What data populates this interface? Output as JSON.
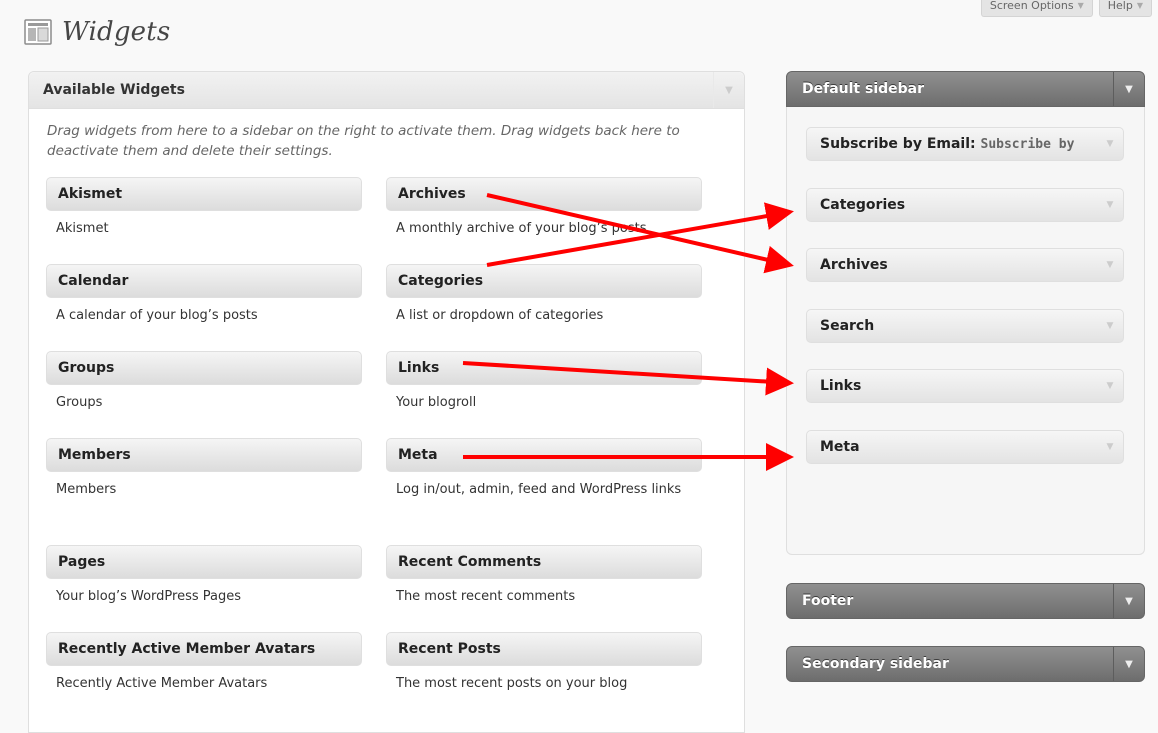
{
  "header": {
    "title": "Widgets",
    "screen_options_label": "Screen Options",
    "help_label": "Help",
    "dropdown_glyph": "▼"
  },
  "available": {
    "title": "Available Widgets",
    "description": "Drag widgets from here to a sidebar on the right to activate them. Drag widgets back here to deactivate them and delete their settings.",
    "widgets": [
      {
        "title": "Akismet",
        "description": "Akismet"
      },
      {
        "title": "Archives",
        "description": "A monthly archive of your blog’s posts"
      },
      {
        "title": "Calendar",
        "description": "A calendar of your blog’s posts"
      },
      {
        "title": "Categories",
        "description": "A list or dropdown of categories"
      },
      {
        "title": "Groups",
        "description": "Groups"
      },
      {
        "title": "Links",
        "description": "Your blogroll"
      },
      {
        "title": "Members",
        "description": "Members"
      },
      {
        "title": "Meta",
        "description": "Log in/out, admin, feed and WordPress links"
      },
      {
        "title": "Pages",
        "description": "Your blog’s WordPress Pages"
      },
      {
        "title": "Recent Comments",
        "description": "The most recent comments"
      },
      {
        "title": "Recently Active Member Avatars",
        "description": "Recently Active Member Avatars"
      },
      {
        "title": "Recent Posts",
        "description": "The most recent posts on your blog"
      }
    ]
  },
  "sidebars": {
    "default": {
      "title": "Default sidebar",
      "widgets": [
        {
          "title": "Subscribe by Email",
          "instance_title": "Subscribe by"
        },
        {
          "title": "Categories"
        },
        {
          "title": "Archives"
        },
        {
          "title": "Search"
        },
        {
          "title": "Links"
        },
        {
          "title": "Meta"
        }
      ]
    },
    "footer": {
      "title": "Footer"
    },
    "secondary": {
      "title": "Secondary sidebar"
    }
  },
  "colors": {
    "annotation_arrow": "#ff0000",
    "sidebar_header": "#7a7a7a"
  }
}
